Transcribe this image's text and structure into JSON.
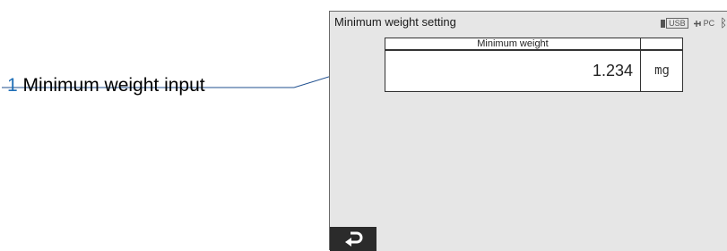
{
  "doc_header": {
    "prefix": "",
    "boxed": "",
    "rest": ""
  },
  "callout": {
    "number": "1",
    "text": "Minimum weight input"
  },
  "screen": {
    "title": "Minimum weight setting",
    "status": {
      "usb": "USB",
      "pc": "PC"
    },
    "field": {
      "header": "Minimum weight",
      "value": "1.234",
      "unit": "mg"
    }
  },
  "icons": {
    "usb": "usb-icon",
    "pc": "pc-connection-icon",
    "bluetooth": "bluetooth-icon",
    "back": "back-arrow-icon"
  }
}
